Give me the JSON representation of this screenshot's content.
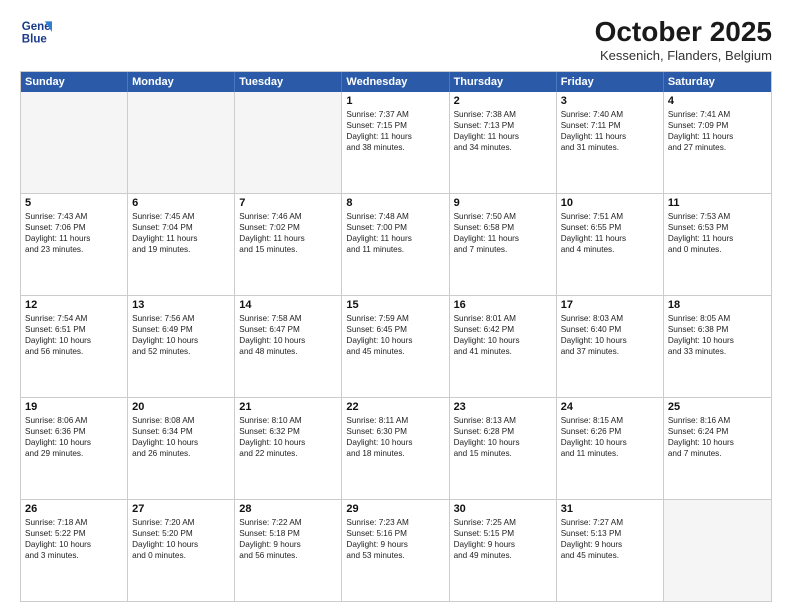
{
  "logo": {
    "line1": "General",
    "line2": "Blue"
  },
  "title": "October 2025",
  "subtitle": "Kessenich, Flanders, Belgium",
  "header_days": [
    "Sunday",
    "Monday",
    "Tuesday",
    "Wednesday",
    "Thursday",
    "Friday",
    "Saturday"
  ],
  "weeks": [
    [
      {
        "day": "",
        "info": ""
      },
      {
        "day": "",
        "info": ""
      },
      {
        "day": "",
        "info": ""
      },
      {
        "day": "1",
        "info": "Sunrise: 7:37 AM\nSunset: 7:15 PM\nDaylight: 11 hours\nand 38 minutes."
      },
      {
        "day": "2",
        "info": "Sunrise: 7:38 AM\nSunset: 7:13 PM\nDaylight: 11 hours\nand 34 minutes."
      },
      {
        "day": "3",
        "info": "Sunrise: 7:40 AM\nSunset: 7:11 PM\nDaylight: 11 hours\nand 31 minutes."
      },
      {
        "day": "4",
        "info": "Sunrise: 7:41 AM\nSunset: 7:09 PM\nDaylight: 11 hours\nand 27 minutes."
      }
    ],
    [
      {
        "day": "5",
        "info": "Sunrise: 7:43 AM\nSunset: 7:06 PM\nDaylight: 11 hours\nand 23 minutes."
      },
      {
        "day": "6",
        "info": "Sunrise: 7:45 AM\nSunset: 7:04 PM\nDaylight: 11 hours\nand 19 minutes."
      },
      {
        "day": "7",
        "info": "Sunrise: 7:46 AM\nSunset: 7:02 PM\nDaylight: 11 hours\nand 15 minutes."
      },
      {
        "day": "8",
        "info": "Sunrise: 7:48 AM\nSunset: 7:00 PM\nDaylight: 11 hours\nand 11 minutes."
      },
      {
        "day": "9",
        "info": "Sunrise: 7:50 AM\nSunset: 6:58 PM\nDaylight: 11 hours\nand 7 minutes."
      },
      {
        "day": "10",
        "info": "Sunrise: 7:51 AM\nSunset: 6:55 PM\nDaylight: 11 hours\nand 4 minutes."
      },
      {
        "day": "11",
        "info": "Sunrise: 7:53 AM\nSunset: 6:53 PM\nDaylight: 11 hours\nand 0 minutes."
      }
    ],
    [
      {
        "day": "12",
        "info": "Sunrise: 7:54 AM\nSunset: 6:51 PM\nDaylight: 10 hours\nand 56 minutes."
      },
      {
        "day": "13",
        "info": "Sunrise: 7:56 AM\nSunset: 6:49 PM\nDaylight: 10 hours\nand 52 minutes."
      },
      {
        "day": "14",
        "info": "Sunrise: 7:58 AM\nSunset: 6:47 PM\nDaylight: 10 hours\nand 48 minutes."
      },
      {
        "day": "15",
        "info": "Sunrise: 7:59 AM\nSunset: 6:45 PM\nDaylight: 10 hours\nand 45 minutes."
      },
      {
        "day": "16",
        "info": "Sunrise: 8:01 AM\nSunset: 6:42 PM\nDaylight: 10 hours\nand 41 minutes."
      },
      {
        "day": "17",
        "info": "Sunrise: 8:03 AM\nSunset: 6:40 PM\nDaylight: 10 hours\nand 37 minutes."
      },
      {
        "day": "18",
        "info": "Sunrise: 8:05 AM\nSunset: 6:38 PM\nDaylight: 10 hours\nand 33 minutes."
      }
    ],
    [
      {
        "day": "19",
        "info": "Sunrise: 8:06 AM\nSunset: 6:36 PM\nDaylight: 10 hours\nand 29 minutes."
      },
      {
        "day": "20",
        "info": "Sunrise: 8:08 AM\nSunset: 6:34 PM\nDaylight: 10 hours\nand 26 minutes."
      },
      {
        "day": "21",
        "info": "Sunrise: 8:10 AM\nSunset: 6:32 PM\nDaylight: 10 hours\nand 22 minutes."
      },
      {
        "day": "22",
        "info": "Sunrise: 8:11 AM\nSunset: 6:30 PM\nDaylight: 10 hours\nand 18 minutes."
      },
      {
        "day": "23",
        "info": "Sunrise: 8:13 AM\nSunset: 6:28 PM\nDaylight: 10 hours\nand 15 minutes."
      },
      {
        "day": "24",
        "info": "Sunrise: 8:15 AM\nSunset: 6:26 PM\nDaylight: 10 hours\nand 11 minutes."
      },
      {
        "day": "25",
        "info": "Sunrise: 8:16 AM\nSunset: 6:24 PM\nDaylight: 10 hours\nand 7 minutes."
      }
    ],
    [
      {
        "day": "26",
        "info": "Sunrise: 7:18 AM\nSunset: 5:22 PM\nDaylight: 10 hours\nand 3 minutes."
      },
      {
        "day": "27",
        "info": "Sunrise: 7:20 AM\nSunset: 5:20 PM\nDaylight: 10 hours\nand 0 minutes."
      },
      {
        "day": "28",
        "info": "Sunrise: 7:22 AM\nSunset: 5:18 PM\nDaylight: 9 hours\nand 56 minutes."
      },
      {
        "day": "29",
        "info": "Sunrise: 7:23 AM\nSunset: 5:16 PM\nDaylight: 9 hours\nand 53 minutes."
      },
      {
        "day": "30",
        "info": "Sunrise: 7:25 AM\nSunset: 5:15 PM\nDaylight: 9 hours\nand 49 minutes."
      },
      {
        "day": "31",
        "info": "Sunrise: 7:27 AM\nSunset: 5:13 PM\nDaylight: 9 hours\nand 45 minutes."
      },
      {
        "day": "",
        "info": ""
      }
    ]
  ]
}
